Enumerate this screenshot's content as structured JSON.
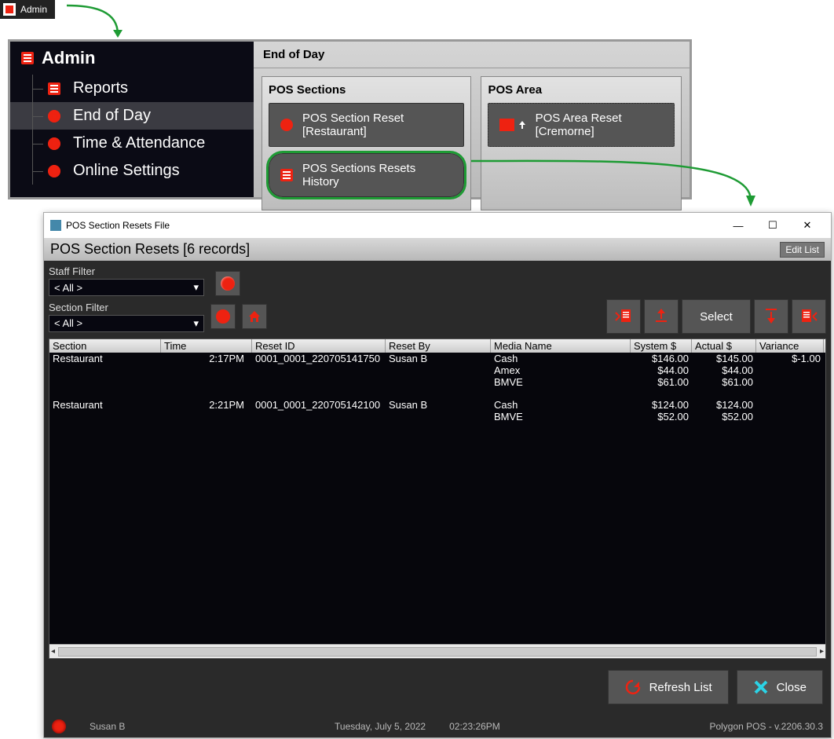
{
  "top_tag": {
    "label": "Admin"
  },
  "sidebar": {
    "root_label": "Admin",
    "items": [
      {
        "label": "Reports",
        "icon": "list"
      },
      {
        "label": "End of Day",
        "icon": "dot",
        "selected": true
      },
      {
        "label": "Time & Attendance",
        "icon": "dot"
      },
      {
        "label": "Online Settings",
        "icon": "dot"
      }
    ]
  },
  "eod": {
    "header": "End of Day",
    "sections": {
      "header": "POS Sections",
      "btn_reset": "POS Section Reset [Restaurant]",
      "btn_history": "POS Sections Resets History"
    },
    "area": {
      "header": "POS Area",
      "btn_reset": "POS Area Reset [Cremorne]"
    }
  },
  "resets_window": {
    "title": "POS Section Resets File",
    "header": "POS Section Resets [6 records]",
    "edit_list": "Edit List",
    "filters": {
      "staff_label": "Staff Filter",
      "staff_value": "< All >",
      "section_label": "Section Filter",
      "section_value": "< All >"
    },
    "toolbar": {
      "select_label": "Select"
    },
    "columns": {
      "section": "Section",
      "time": "Time",
      "reset_id": "Reset ID",
      "reset_by": "Reset By",
      "media": "Media Name",
      "system": "System $",
      "actual": "Actual $",
      "variance": "Variance"
    },
    "rows": [
      {
        "section": "Restaurant",
        "time": "2:17PM",
        "reset_id": "0001_0001_220705141750",
        "reset_by": "Susan B",
        "lines": [
          {
            "media": "Cash",
            "system": "$146.00",
            "actual": "$145.00",
            "variance": "$-1.00"
          },
          {
            "media": "Amex",
            "system": "$44.00",
            "actual": "$44.00",
            "variance": ""
          },
          {
            "media": "BMVE",
            "system": "$61.00",
            "actual": "$61.00",
            "variance": ""
          }
        ]
      },
      {
        "section": "Restaurant",
        "time": "2:21PM",
        "reset_id": "0001_0001_220705142100",
        "reset_by": "Susan B",
        "lines": [
          {
            "media": "Cash",
            "system": "$124.00",
            "actual": "$124.00",
            "variance": ""
          },
          {
            "media": "BMVE",
            "system": "$52.00",
            "actual": "$52.00",
            "variance": ""
          }
        ]
      }
    ],
    "footer": {
      "refresh": "Refresh List",
      "close": "Close"
    }
  },
  "status": {
    "user": "Susan B",
    "date": "Tuesday, July  5, 2022",
    "time": "02:23:26PM",
    "version": "Polygon POS - v.2206.30.3"
  },
  "colors": {
    "accent": "#e21b1b",
    "highlight": "#1e9b34"
  }
}
